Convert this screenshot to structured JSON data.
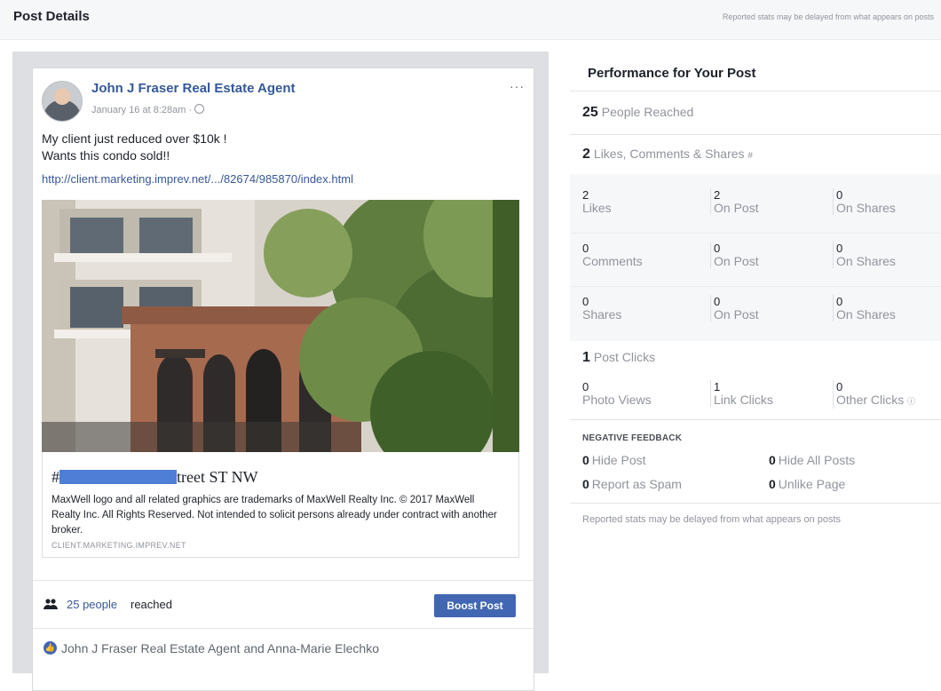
{
  "header": {
    "title": "Post Details",
    "note": "Reported stats may be delayed from what appears on posts"
  },
  "post": {
    "author": "John J Fraser Real Estate Agent",
    "timestamp": "January 16 at 8:28am ·",
    "more": "···",
    "message_line1": "My client just reduced over $10k !",
    "message_line2": "Wants this condo sold!!",
    "link_url": "http://client.marketing.imprev.net/.../82674/985870/index.html",
    "link_title_prefix": "#",
    "link_title_suffix": "treet ST NW",
    "link_description": "MaxWell logo and all related graphics are trademarks of MaxWell Realty Inc. © 2017 MaxWell Realty Inc. All Rights Reserved. Not intended to solicit persons already under contract with another broker.",
    "link_domain": "CLIENT.MARKETING.IMPREV.NET",
    "reach_count": "25 people",
    "reach_suffix": "reached",
    "boost_label": "Boost Post",
    "liked_by": "John J Fraser Real Estate Agent and Anna-Marie Elechko"
  },
  "performance": {
    "title": "Performance for Your Post",
    "people_reached": {
      "value": "25",
      "label": "People Reached"
    },
    "engagement": {
      "value": "2",
      "label": "Likes, Comments & Shares"
    },
    "likes": {
      "total": "2",
      "total_label": "Likes",
      "on_post": "2",
      "on_post_label": "On Post",
      "on_shares": "0",
      "on_shares_label": "On Shares"
    },
    "comments": {
      "total": "0",
      "total_label": "Comments",
      "on_post": "0",
      "on_post_label": "On Post",
      "on_shares": "0",
      "on_shares_label": "On Shares"
    },
    "shares": {
      "total": "0",
      "total_label": "Shares",
      "on_post": "0",
      "on_post_label": "On Post",
      "on_shares": "0",
      "on_shares_label": "On Shares"
    },
    "post_clicks": {
      "value": "1",
      "label": "Post Clicks"
    },
    "clicks": {
      "photo_views": "0",
      "photo_views_label": "Photo Views",
      "link_clicks": "1",
      "link_clicks_label": "Link Clicks",
      "other_clicks": "0",
      "other_clicks_label": "Other Clicks"
    },
    "negative_feedback": {
      "heading": "NEGATIVE FEEDBACK",
      "hide_post": "0",
      "hide_post_label": "Hide Post",
      "hide_all": "0",
      "hide_all_label": "Hide All Posts",
      "spam": "0",
      "spam_label": "Report as Spam",
      "unlike": "0",
      "unlike_label": "Unlike Page"
    },
    "footer": "Reported stats may be delayed from what appears on posts"
  }
}
